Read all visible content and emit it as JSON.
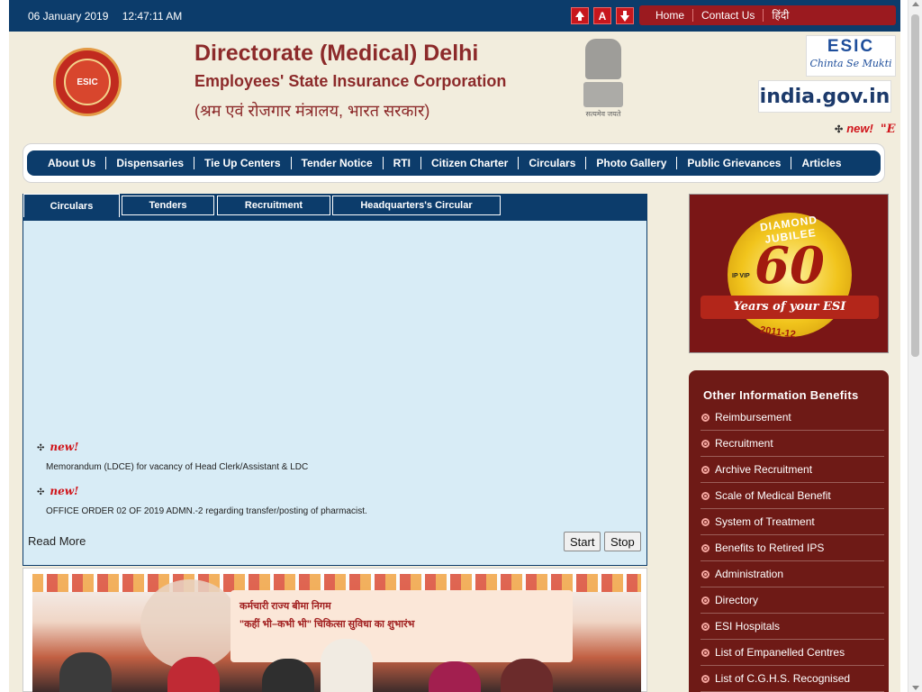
{
  "topbar": {
    "date": "06 January 2019",
    "time": "12:47:11 AM",
    "font_increase_label": "",
    "font_normal_label": "A",
    "font_decrease_label": "",
    "links": [
      "Home",
      "Contact Us",
      "हिंदी"
    ]
  },
  "header": {
    "title": "Directorate (Medical) Delhi",
    "subtitle": "Employees' State Insurance Corporation",
    "ministry_hindi": "(श्रम एवं रोजगार मंत्रालय, भारत सरकार)",
    "emblem_motto": "सत्यमेव जयते",
    "esic_logo_text": "ESIC",
    "esic_logo_tagline": "Chinta Se Mukti",
    "logo_inner_text": "ESIC",
    "india_gov_text": "india.gov.in",
    "marquee_new": "new!",
    "marquee_text": "\"E"
  },
  "nav": {
    "items": [
      "About Us",
      "Dispensaries",
      "Tie Up Centers",
      "Tender Notice",
      "RTI",
      "Citizen Charter",
      "Circulars",
      "Photo Gallery",
      "Public Grievances",
      "Articles"
    ]
  },
  "tabs": {
    "items": [
      "Circulars",
      "Tenders",
      "Recruitment",
      "Headquarters's Circular"
    ],
    "active": "Circulars"
  },
  "circulars": {
    "items": [
      {
        "tag": "new!",
        "text": "Memorandum (LDCE) for vacancy of Head Clerk/Assistant & LDC"
      },
      {
        "tag": "new!",
        "text": "OFFICE ORDER 02 OF 2019 ADMN.-2 regarding transfer/posting of pharmacist."
      }
    ],
    "read_more": "Read More",
    "start_label": "Start",
    "stop_label": "Stop"
  },
  "photo": {
    "banner_line1": "कर्मचारी राज्य बीमा निगम",
    "banner_line2": "\"कहीं भी–कभी भी\" चिकित्सा सुविधा का शुभारंभ"
  },
  "jubilee": {
    "arc_text": "DIAMOND JUBILEE",
    "number": "60",
    "ribbon": "Years of your ESI",
    "years": "2011-12",
    "ip_text": "IP\nVIP"
  },
  "sidebar": {
    "title": "Other Information Benefits",
    "items": [
      "Reimbursement",
      "Recruitment",
      "Archive Recruitment",
      "Scale of Medical Benefit",
      "System of Treatment",
      "Benefits to Retired IPS",
      "Administration",
      "Directory",
      "ESI Hospitals",
      "List of Empanelled Centres",
      "List of C.G.H.S. Recognised"
    ]
  },
  "colors": {
    "topbar_bg": "#0c3c6b",
    "brand_red": "#9b1a1f",
    "page_bg": "#f2eddd",
    "title_color": "#8c2a2a",
    "circular_bg": "#d8ecf6",
    "sidebar_bg": "#6e1a16"
  }
}
